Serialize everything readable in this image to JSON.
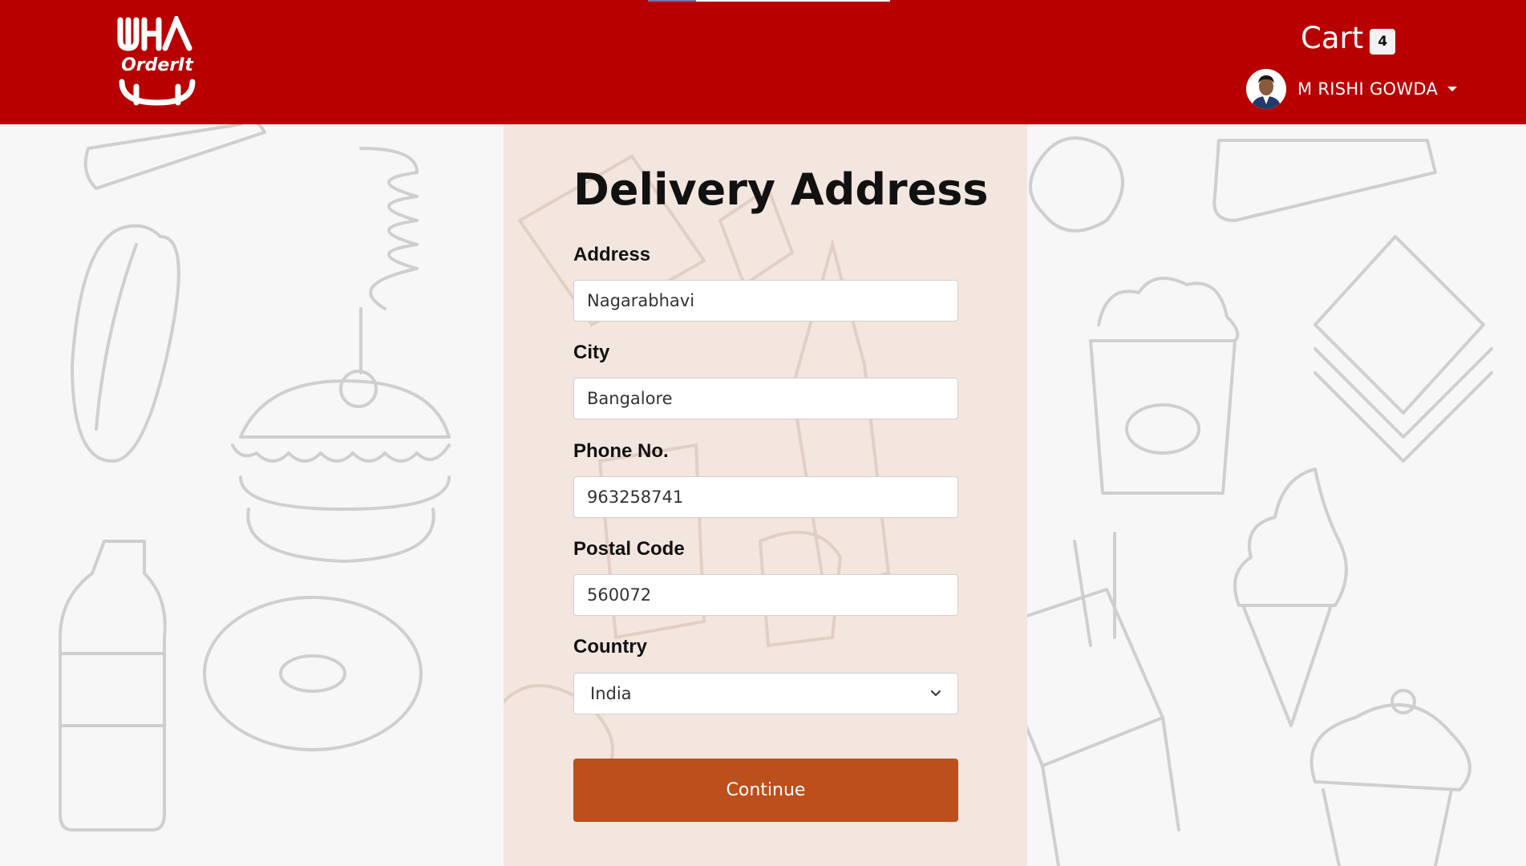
{
  "header": {
    "logo_text": "OrderIt",
    "cart_label": "Cart",
    "cart_count": "4",
    "user_name": "M RISHI GOWDA"
  },
  "form": {
    "title": "Delivery Address",
    "fields": [
      {
        "label": "Address",
        "value": "Nagarabhavi"
      },
      {
        "label": "City",
        "value": "Bangalore"
      },
      {
        "label": "Phone No.",
        "value": "963258741"
      },
      {
        "label": "Postal Code",
        "value": "560072"
      }
    ],
    "country": {
      "label": "Country",
      "selected": "India"
    },
    "submit_label": "Continue"
  },
  "colors": {
    "header_bg": "#b90000",
    "panel_bg": "#f3e6df",
    "button_bg": "#bd4f1c",
    "page_bg": "#f7f7f7"
  },
  "icons": {
    "logo": "orderit-logo-icon",
    "avatar": "user-avatar-icon",
    "caret": "caret-down-icon",
    "select": "chevron-down-icon"
  }
}
